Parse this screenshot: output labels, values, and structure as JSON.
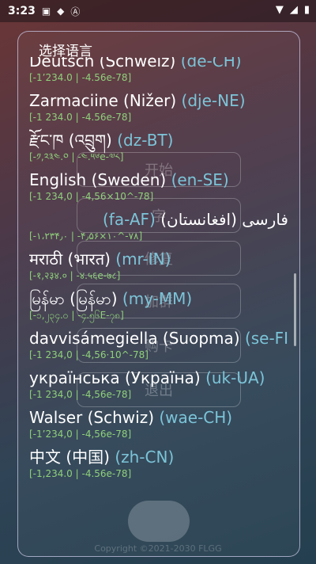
{
  "status": {
    "time": "3:23"
  },
  "background": {
    "buttons": [
      "开始",
      "字",
      "修复",
      "加群",
      "购卡",
      "退出"
    ],
    "copyright": "Copyright ©2021-2030 FLGG"
  },
  "dialog": {
    "title": "选择语言",
    "items": [
      {
        "name": "Deutsch (Schweiz)",
        "code": "(de-CH)",
        "sample": "[-1’234.0 | -4.56e-78]"
      },
      {
        "name": "Zarmaciine (Nižer)",
        "code": "(dje-NE)",
        "sample": "[-1 234.0 | -4.56e-78]"
      },
      {
        "name": "རྫོང་ཁ (འབྲུག)",
        "code": "(dz-BT)",
        "sample": "[-༡,༢༣༤.༠ | -༤.༥༦e-༧༨]"
      },
      {
        "name": "English (Sweden)",
        "code": "(en-SE)",
        "sample": "[-1 234,0 | -4,56×10^-78]"
      },
      {
        "name": "فارسی (افغانستان)",
        "code": "(fa-AF)",
        "sample": "[-۱،۲۳۴٫۰ | -۴٫۵۶×۱۰^-۷۸]",
        "rtl": true
      },
      {
        "name": "मराठी (भारत)",
        "code": "(mr-IN)",
        "sample": "[-१,२३४.० | -४.५६e-७८]"
      },
      {
        "name": "မြန်မာ (မြန်မာ)",
        "code": "(my-MM)",
        "sample": "[-၁,၂၃၄.၀ | -၄.၅၆E-၇၈]"
      },
      {
        "name": "davvisámegiella (Suopma)",
        "code": "(se-FI)",
        "sample": "[-1 234,0 | -4,56·10^-78]"
      },
      {
        "name": "українська (Україна)",
        "code": "(uk-UA)",
        "sample": "[-1 234,0 | -4,56e-78]"
      },
      {
        "name": "Walser (Schwiz)",
        "code": "(wae-CH)",
        "sample": "[-1’234,0 | -4,56e-78]"
      },
      {
        "name": "中文 (中国)",
        "code": "(zh-CN)",
        "sample": "[-1,234.0 | -4.56e-78]"
      }
    ]
  }
}
